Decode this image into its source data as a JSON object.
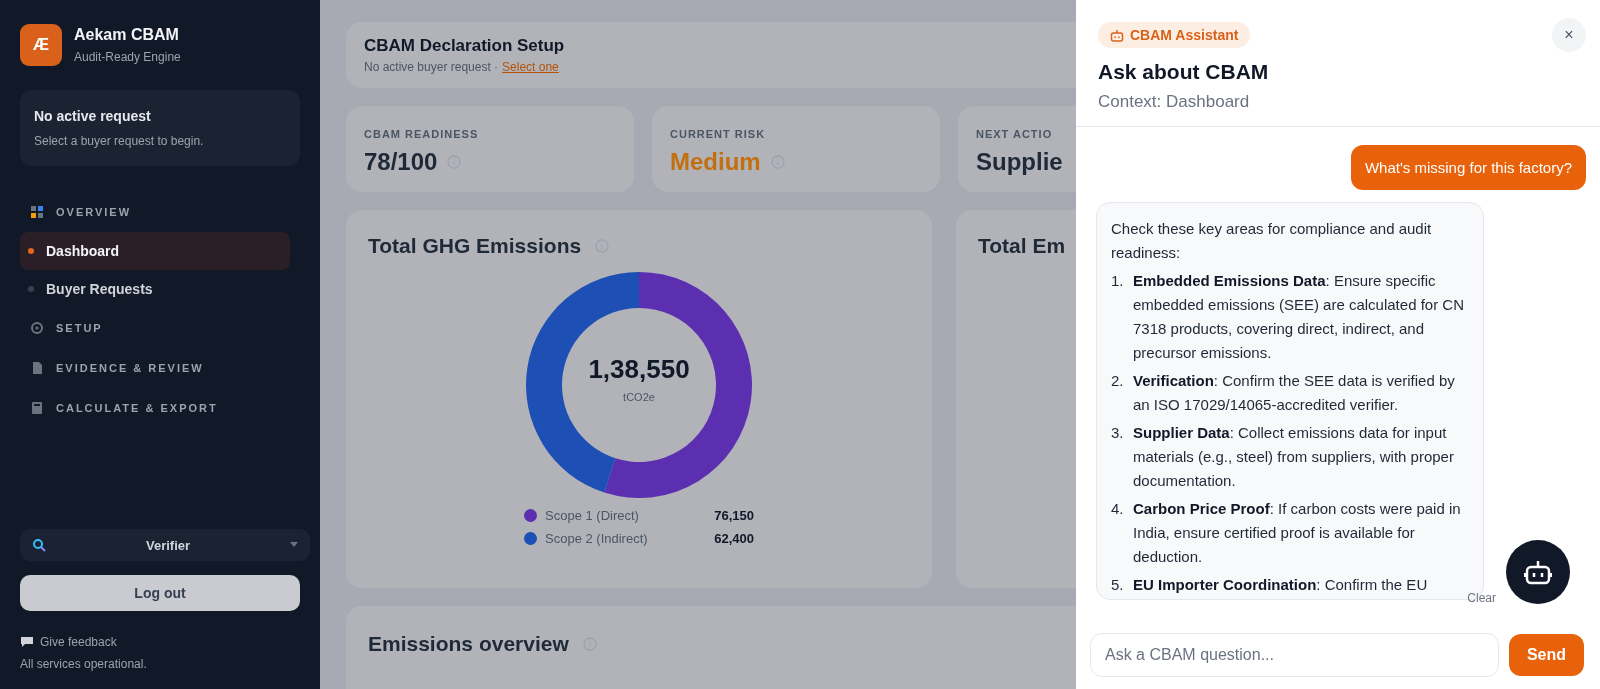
{
  "sidebar": {
    "logo": "Æ",
    "brand": "Aekam CBAM",
    "tagline": "Audit-Ready Engine",
    "request_card": {
      "title": "No active request",
      "hint": "Select a buyer request to begin."
    },
    "nav": [
      {
        "kind": "section",
        "label": "OVERVIEW"
      },
      {
        "kind": "item",
        "label": "Dashboard",
        "selected": true
      },
      {
        "kind": "item",
        "label": "Buyer Requests",
        "selected": false
      },
      {
        "kind": "section",
        "label": "SETUP"
      },
      {
        "kind": "section",
        "label": "EVIDENCE & REVIEW"
      },
      {
        "kind": "section",
        "label": "CALCULATE & EXPORT"
      }
    ],
    "role": "Verifier",
    "logout": "Log out",
    "feedback": "Give feedback",
    "status": "All services operational."
  },
  "header": {
    "title": "CBAM Declaration Setup",
    "subtitle": "No active buyer request ·",
    "link": "Select one"
  },
  "kpis": [
    {
      "label": "CBAM READINESS",
      "value": "78/100",
      "color": "#1f2937"
    },
    {
      "label": "CURRENT RISK",
      "value": "Medium",
      "color": "#c2700f"
    },
    {
      "label": "NEXT ACTIO",
      "value": "Supplie",
      "color": "#1f2937"
    }
  ],
  "emissions_card": {
    "title": "Total GHG Emissions",
    "total": "1,38,550",
    "unit": "tCO2e",
    "chart_data": {
      "type": "donut",
      "categories": [
        "Scope 1 (Direct)",
        "Scope 2 (Indirect)"
      ],
      "values": [
        54.96,
        45.04
      ]
    },
    "legend": [
      {
        "value": "76,150",
        "color": "#5b2fb0"
      },
      {
        "value": "62,400",
        "color": "#1e4fb4"
      }
    ]
  },
  "second_card": {
    "title": "Total Em"
  },
  "overview_card": {
    "title": "Emissions overview"
  },
  "assistant": {
    "badge": "CBAM Assistant",
    "close": "×",
    "title": "Ask about CBAM",
    "context": "Context: Dashboard",
    "user_message": "What's missing for this factory?",
    "reply_intro": "Check these key areas for compliance and audit readiness:",
    "reply_items": [
      {
        "number": "1.",
        "text": "**Embedded Emissions Data**: Ensure specific embedded emissions (SEE) are calculated for CN 7318 products, covering direct, indirect, and precursor emissions."
      },
      {
        "number": "2.",
        "text": "**Verification**: Confirm the SEE data is verified by an ISO 17029/14065-accredited verifier."
      },
      {
        "number": "3.",
        "text": "**Supplier Data**: Collect emissions data for input materials (e.g., steel) from suppliers, with proper documentation."
      },
      {
        "number": "4.",
        "text": "**Carbon Price Proof**: If carbon costs were paid in India, ensure certified proof is available for deduction."
      },
      {
        "number": "5.",
        "text": "**EU Importer Coordination**: Confirm the EU"
      }
    ],
    "clear": "Clear",
    "placeholder": "Ask a CBAM question...",
    "send": "Send"
  }
}
